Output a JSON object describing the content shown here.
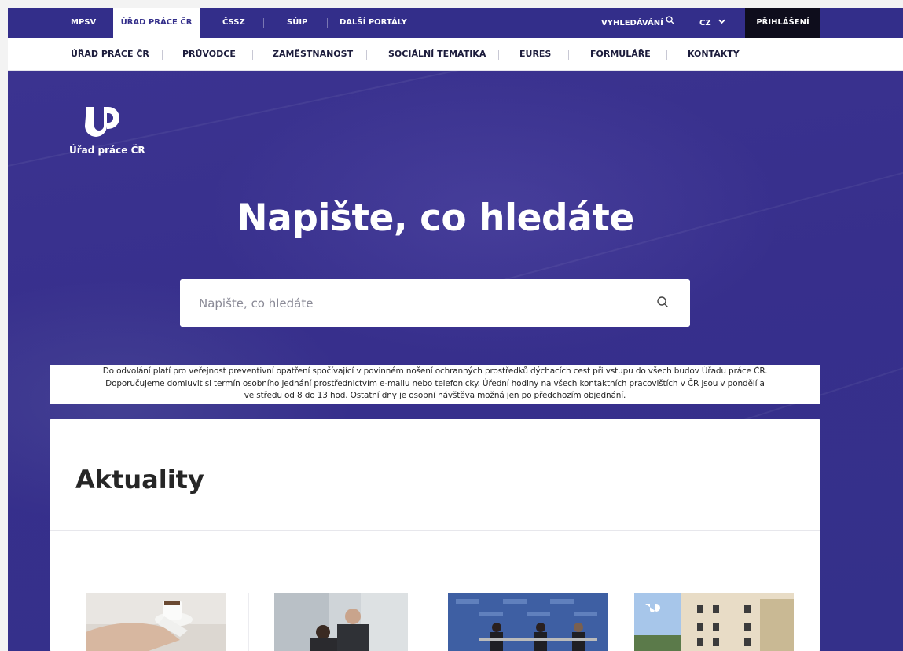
{
  "portal_bar": {
    "items": [
      "MPSV",
      "ÚŘAD PRÁCE ČR",
      "ČSSZ",
      "SÚIP",
      "DALŠÍ PORTÁLY"
    ],
    "search_label": "VYHLEDÁVÁNÍ",
    "language": "CZ",
    "login_label": "PŘIHLÁŠENÍ"
  },
  "main_nav": {
    "items": [
      "ÚŘAD PRÁCE ČR",
      "PRŮVODCE",
      "ZAMĚSTNANOST",
      "SOCIÁLNÍ TEMATIKA",
      "EURES",
      "FORMULÁŘE",
      "KONTAKTY"
    ]
  },
  "logo": {
    "text": "Úřad práce ČR"
  },
  "hero": {
    "title": "Napište, co hledáte",
    "search_placeholder": "Napište, co hledáte"
  },
  "notice": {
    "line1": "Do odvolání platí pro veřejnost preventivní opatření spočívající v povinném nošení ochranných prostředků dýchacích cest při vstupu do všech budov Úřadu práce ČR.",
    "line2": "Doporučujeme domluvit si termín osobního jednání prostřednictvím e-mailu nebo telefonicky. Úřední hodiny na všech kontaktních pracovištích v ČR jsou v pondělí a",
    "line3": "ve středu od 8 do 13 hod. Ostatní dny je osobní návštěva možná jen po předchozím objednání."
  },
  "news": {
    "title": "Aktuality"
  },
  "colors": {
    "brand_primary": "#332e8a",
    "login_bg": "#0e0d1c",
    "hero_bg": "#372f8c"
  },
  "icons": {
    "search": "search-icon",
    "language_chevron": "chevron-down-icon"
  }
}
